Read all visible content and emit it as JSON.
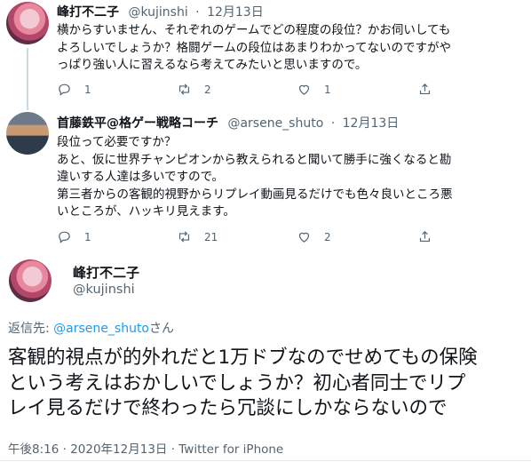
{
  "tweet1": {
    "name": "峰打不二子",
    "handle": "@kujinshi",
    "dot": "·",
    "date": "12月13日",
    "lines": [
      "横からすいません、それぞれのゲームでどの程度の段位？かお伺いしても",
      "よろしいでしょうか？格闘ゲームの段位はあまりわかってないのですがや",
      "っぱり強い人に習えるなら考えてみたいと思いますので。"
    ],
    "reply_count": "1",
    "retweet_count": "2",
    "like_count": "1",
    "icons": [
      "reply-icon",
      "retweet-icon",
      "like-icon",
      "share-icon"
    ]
  },
  "tweet2": {
    "name": "首藤鉄平@格ゲー戦略コーチ",
    "handle": "@arsene_shuto",
    "dot": "·",
    "date": "12月13日",
    "lines": [
      "段位って必要ですか？",
      "あと、仮に世界チャンピオンから教えられると聞いて勝手に強くなると勘",
      "違いする人達は多いですので。",
      "第三者からの客観的視野からリプレイ動画見るだけでも色々良いところ悪",
      "いところが、ハッキリ見えます。"
    ],
    "reply_count": "1",
    "retweet_count": "21",
    "like_count": "2",
    "icons": [
      "reply-icon",
      "retweet-icon",
      "like-icon",
      "share-icon"
    ]
  },
  "main": {
    "name": "峰打不二子",
    "handle": "@kujinshi",
    "reply_prefix": "返信先: ",
    "reply_mention": "@arsene_shuto",
    "reply_suffix": "さん",
    "lines": [
      "客観的視点が的外れだと1万ドブなのでせめてもの保険",
      "という考えはおかしいでしょうか？初心者同士でリプ",
      "レイ見るだけで終わったら冗談にしかならないので"
    ],
    "timestamp": "午後8:16 · 2020年12月13日 · ",
    "source": "Twitter for iPhone"
  },
  "colors": {
    "text": "#0f1419",
    "muted": "#536471",
    "link": "#1d9bf0",
    "divider": "#e6ecf0"
  }
}
